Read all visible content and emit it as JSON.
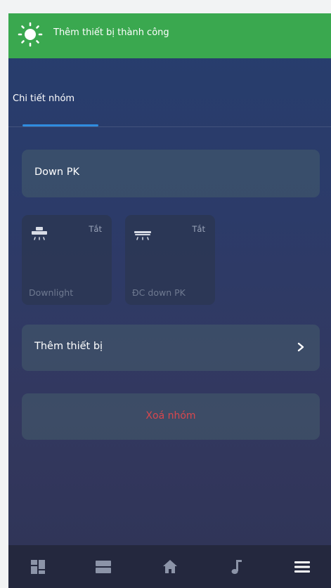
{
  "toast": {
    "icon": "sun-icon",
    "message": "Thêm thiết bị thành công",
    "color": "#3aa84f"
  },
  "tabs": [
    {
      "label": "Chi tiết nhóm",
      "active": true
    }
  ],
  "group": {
    "name": "Down PK"
  },
  "devices": [
    {
      "icon": "downlight-icon",
      "state": "Tắt",
      "name": "Downlight"
    },
    {
      "icon": "ceiling-ac-icon",
      "state": "Tắt",
      "name": "ĐC down PK"
    }
  ],
  "actions": {
    "add_device_label": "Thêm thiết bị",
    "delete_group_label": "Xoá nhóm"
  },
  "bottom_nav": [
    {
      "icon": "dashboard-icon"
    },
    {
      "icon": "list-icon"
    },
    {
      "icon": "home-icon"
    },
    {
      "icon": "music-icon"
    },
    {
      "icon": "menu-icon"
    }
  ],
  "colors": {
    "accent": "#2f8de0",
    "danger": "#d9474d"
  }
}
